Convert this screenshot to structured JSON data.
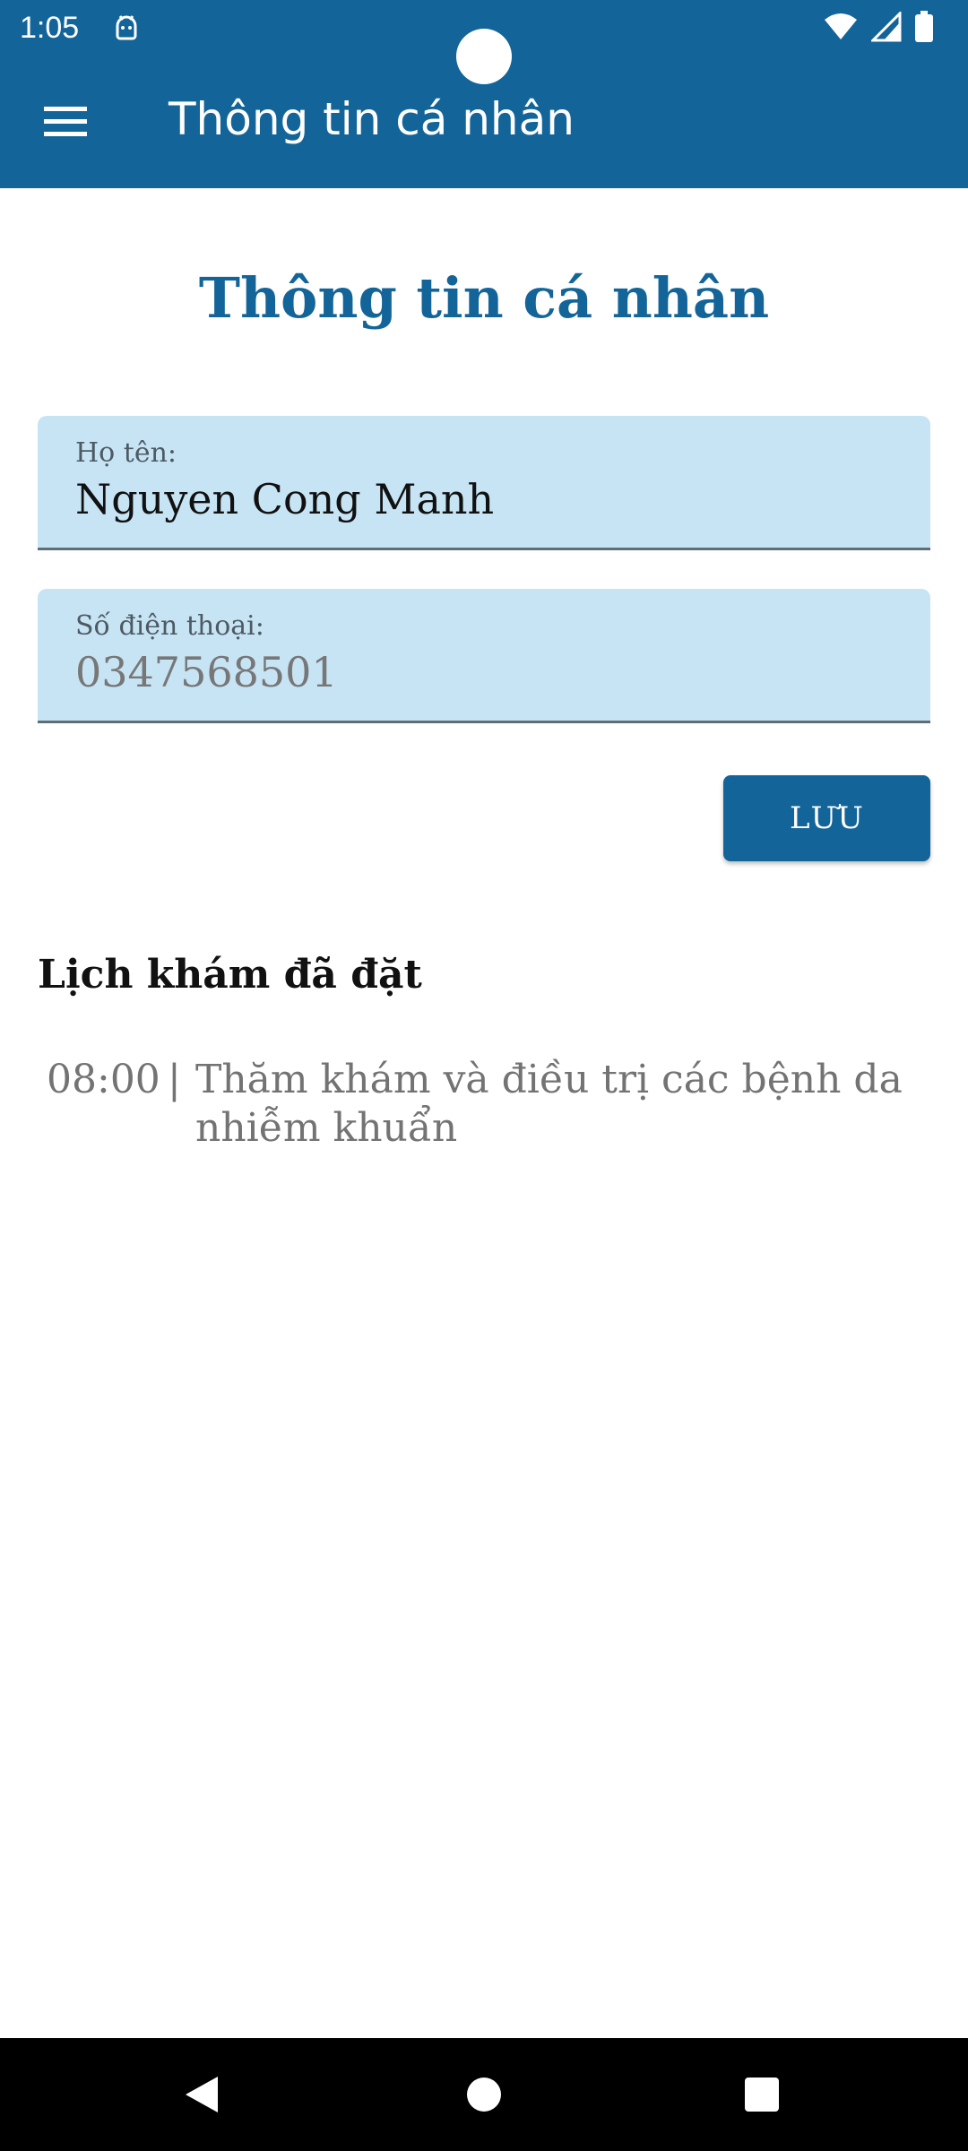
{
  "status_bar": {
    "time": "1:05",
    "notification_icon": "android-debug-icon",
    "icons": [
      "wifi-icon",
      "signal-icon",
      "battery-icon"
    ]
  },
  "app_bar": {
    "menu_icon": "menu-icon",
    "title": "Thông tin cá nhân",
    "color": "#136599"
  },
  "page": {
    "title": "Thông tin cá nhân"
  },
  "form": {
    "name": {
      "label": "Họ tên:",
      "value": "Nguyen Cong Manh"
    },
    "phone": {
      "label": "Số điện thoại:",
      "value": "0347568501"
    },
    "field_background": "#c7e4f5",
    "save_label": "LƯU"
  },
  "appointments": {
    "heading": "Lịch khám đã đặt",
    "items": [
      {
        "time": "08:00",
        "separator": "|",
        "description": "Thăm khám và điều trị các bệnh da nhiễm khuẩn"
      }
    ]
  },
  "nav_bar": {
    "icons": [
      "back-icon",
      "home-icon",
      "recents-icon"
    ]
  }
}
